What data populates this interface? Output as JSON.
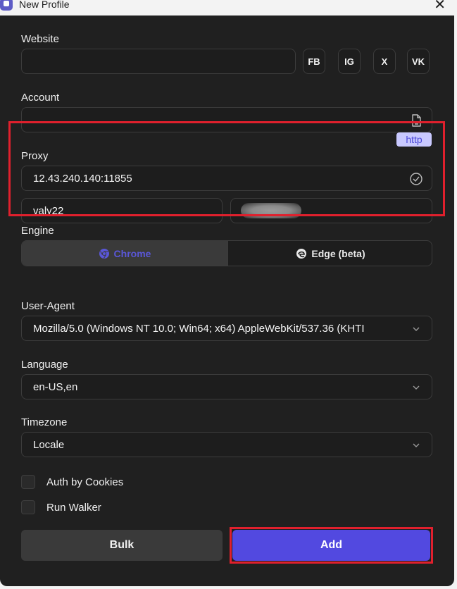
{
  "window": {
    "title": "New Profile",
    "close_glyph": "✕"
  },
  "website": {
    "label": "Website",
    "value": "",
    "shortcuts": [
      "FB",
      "IG",
      "X",
      "VK"
    ]
  },
  "account": {
    "label": "Account",
    "value": "",
    "icon": "file-icon"
  },
  "proxy": {
    "label": "Proxy",
    "type_badge": "http",
    "address": "12.43.240.140:11855",
    "username": "valy22",
    "password_obscured": true,
    "status_icon": "check-circle-icon"
  },
  "engine": {
    "label": "Engine",
    "options": [
      {
        "label": "Chrome",
        "icon": "chrome-icon",
        "selected": true
      },
      {
        "label": "Edge (beta)",
        "icon": "edge-icon",
        "selected": false
      }
    ]
  },
  "user_agent": {
    "label": "User-Agent",
    "value": "Mozilla/5.0 (Windows NT 10.0; Win64; x64) AppleWebKit/537.36 (KHTI"
  },
  "language": {
    "label": "Language",
    "value": "en-US,en"
  },
  "timezone": {
    "label": "Timezone",
    "value": "Locale"
  },
  "options": [
    {
      "label": "Auth by Cookies",
      "checked": false
    },
    {
      "label": "Run Walker",
      "checked": false
    }
  ],
  "actions": {
    "bulk_label": "Bulk",
    "add_label": "Add"
  },
  "colors": {
    "accent": "#5249e0",
    "highlight_frame": "#e0202d",
    "panel_bg": "#202020"
  }
}
